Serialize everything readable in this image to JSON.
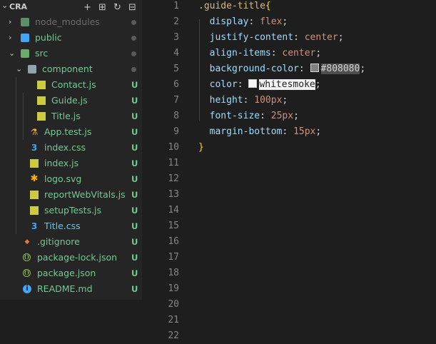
{
  "explorer": {
    "title": "CRA",
    "actions": [
      {
        "name": "new-file-icon",
        "glyph": "+"
      },
      {
        "name": "new-folder-icon",
        "glyph": "⊞"
      },
      {
        "name": "refresh-icon",
        "glyph": "↻"
      },
      {
        "name": "collapse-all-icon",
        "glyph": "⊟"
      }
    ],
    "items": [
      {
        "label": "node_modules",
        "kind": "folder",
        "chev": "›",
        "color": "#5d8d6a",
        "status": "dot",
        "muted": true
      },
      {
        "label": "public",
        "kind": "folder",
        "chev": "›",
        "color": "#42a5f5",
        "status": "dot"
      },
      {
        "label": "src",
        "kind": "folder-open",
        "chev": "⌄",
        "color": "#6aaa6a",
        "status": "dot"
      },
      {
        "label": "component",
        "kind": "folder-open",
        "chev": "⌄",
        "color": "#90a4ae",
        "status": "dot"
      },
      {
        "label": "Contact.js",
        "kind": "js",
        "status": "U"
      },
      {
        "label": "Guide.js",
        "kind": "js",
        "status": "U"
      },
      {
        "label": "Title.js",
        "kind": "js",
        "status": "U"
      },
      {
        "label": "App.test.js",
        "kind": "test",
        "status": "U"
      },
      {
        "label": "index.css",
        "kind": "css",
        "status": "U"
      },
      {
        "label": "index.js",
        "kind": "js",
        "status": "U"
      },
      {
        "label": "logo.svg",
        "kind": "svg",
        "status": "U"
      },
      {
        "label": "reportWebVitals.js",
        "kind": "js",
        "status": "U"
      },
      {
        "label": "setupTests.js",
        "kind": "js",
        "status": "U"
      },
      {
        "label": "Title.css",
        "kind": "css",
        "status": "U",
        "active": true
      },
      {
        "label": ".gitignore",
        "kind": "git",
        "status": "U"
      },
      {
        "label": "package-lock.json",
        "kind": "json",
        "status": "U"
      },
      {
        "label": "package.json",
        "kind": "json",
        "status": "U"
      },
      {
        "label": "README.md",
        "kind": "info",
        "status": "U"
      }
    ]
  },
  "editor": {
    "line_numbers": [
      "1",
      "2",
      "3",
      "4",
      "5",
      "6",
      "7",
      "8",
      "9",
      "10",
      "11",
      "12",
      "13",
      "14",
      "15",
      "16",
      "17",
      "18",
      "19",
      "20",
      "21",
      "22"
    ],
    "code": {
      "l1_selector": ".guide-title",
      "l1_brace": "{",
      "l2_prop": "display",
      "l2_val": "flex",
      "l3_prop": "justify-content",
      "l3_val": "center",
      "l4_prop": "align-items",
      "l4_val": "center",
      "l5_prop": "background-color",
      "l5_val": "#808080",
      "l6_prop": "color",
      "l6_val": "whitesmoke",
      "l7_prop": "height",
      "l7_val": "100px",
      "l8_prop": "font-size",
      "l8_val": "25px",
      "l9_prop": "margin-bottom",
      "l9_val": "15px",
      "l10_brace": "}"
    },
    "swatch_colors": {
      "gray": "#808080",
      "white": "#f5f5f5"
    }
  },
  "colors": {
    "untracked": "#73c991",
    "folder_dot": "#5a5a5a",
    "active_file": "#6fc3df"
  }
}
